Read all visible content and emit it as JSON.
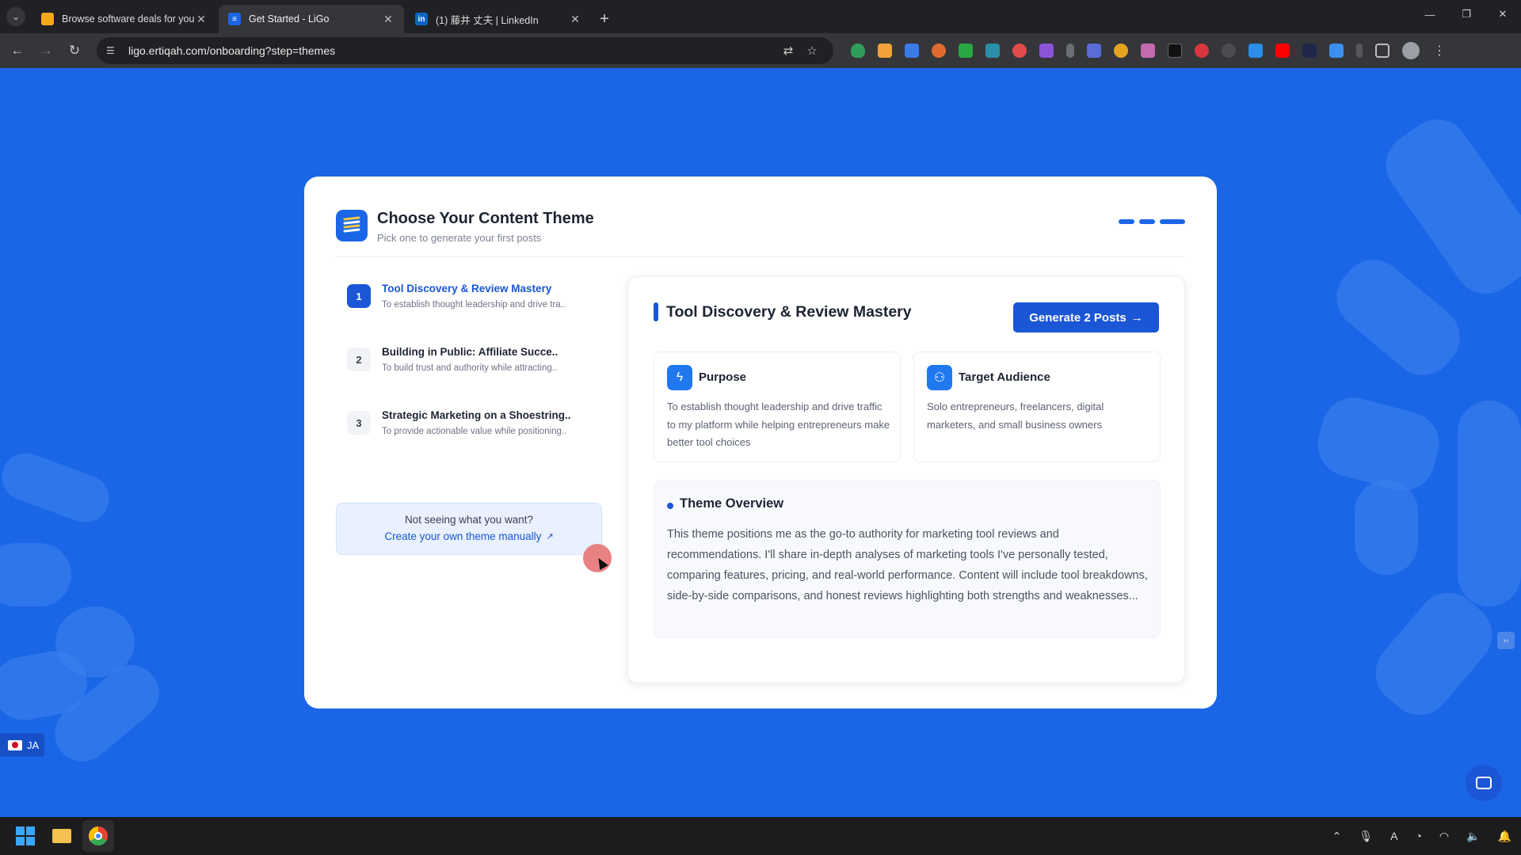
{
  "browser": {
    "tabs": [
      {
        "title": "Browse software deals for your",
        "favicon_color": "#f4a81d",
        "active": false
      },
      {
        "title": "Get Started - LiGo",
        "favicon_color": "#1a66e6",
        "active": true
      },
      {
        "title": "(1) 藤井 丈夫 | LinkedIn",
        "favicon_color": "#0a66c2",
        "favicon_text": "in",
        "active": false
      }
    ],
    "new_tab_symbol": "+",
    "url": "ligo.ertiqah.com/onboarding?step=themes"
  },
  "header": {
    "title": "Choose Your Content Theme",
    "subtitle": "Pick one to generate your first posts"
  },
  "themes": [
    {
      "num": "1",
      "title": "Tool Discovery & Review Mastery",
      "desc": "To establish thought leadership and drive tra..",
      "active": true
    },
    {
      "num": "2",
      "title": "Building in Public: Affiliate Succe..",
      "desc": "To build trust and authority while attracting..",
      "active": false
    },
    {
      "num": "3",
      "title": "Strategic Marketing on a Shoestring..",
      "desc": "To provide actionable value while positioning..",
      "active": false
    }
  ],
  "custom": {
    "question": "Not seeing what you want?",
    "link": "Create your own theme manually"
  },
  "detail": {
    "title": "Tool Discovery & Review Mastery",
    "generate_label": "Generate 2 Posts",
    "purpose": {
      "label": "Purpose",
      "text": "To establish thought leadership and drive traffic to my platform while helping entrepreneurs make better tool choices"
    },
    "audience": {
      "label": "Target Audience",
      "text": "Solo entrepreneurs, freelancers, digital marketers, and small business owners"
    },
    "overview": {
      "label": "Theme Overview",
      "text": "This theme positions me as the go-to authority for marketing tool reviews and recommendations. I'll share in-depth analyses of marketing tools I've personally tested, comparing features, pricing, and real-world performance. Content will include tool breakdowns, side-by-side comparisons, and honest reviews highlighting both strengths and weaknesses..."
    }
  },
  "language_badge": "JA",
  "colors": {
    "brand": "#1a66e6",
    "accent": "#1a56d6"
  }
}
